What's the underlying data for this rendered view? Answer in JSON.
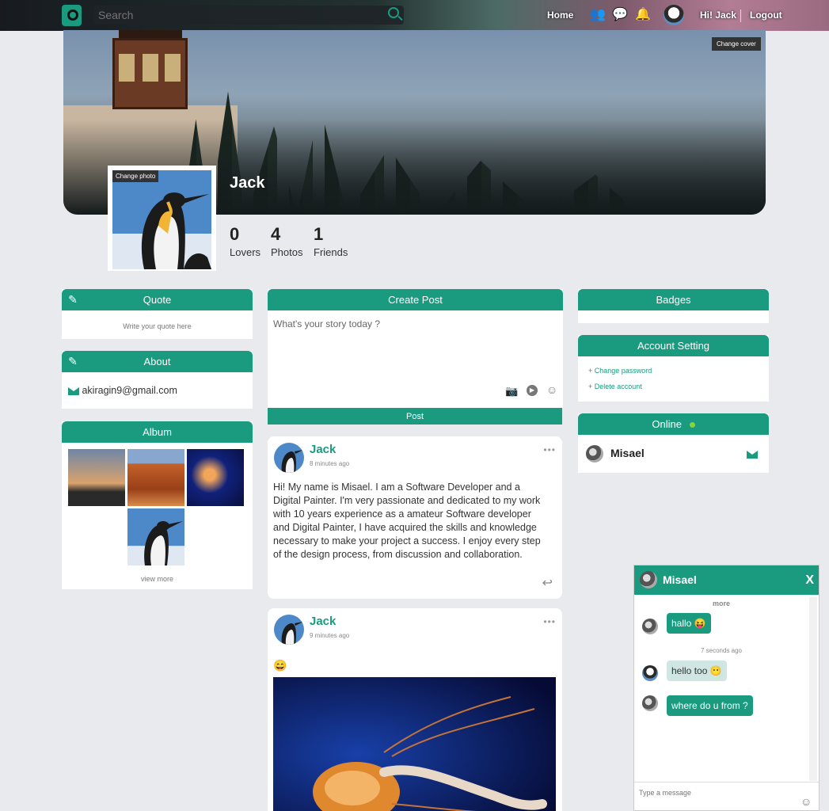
{
  "nav": {
    "search_placeholder": "Search",
    "home": "Home",
    "greeting": "Hi! Jack",
    "logout": "Logout"
  },
  "profile": {
    "name": "Jack",
    "change_cover": "Change cover",
    "change_photo": "Change photo",
    "stats": [
      {
        "num": "0",
        "label": "Lovers"
      },
      {
        "num": "4",
        "label": "Photos"
      },
      {
        "num": "1",
        "label": "Friends"
      }
    ]
  },
  "quote": {
    "title": "Quote",
    "placeholder": "Write your quote here"
  },
  "about": {
    "title": "About",
    "email": "akiragin9@gmail.com"
  },
  "album": {
    "title": "Album",
    "view_more": "view more"
  },
  "create_post": {
    "title": "Create Post",
    "placeholder": "What's your story today ?",
    "post_button": "Post"
  },
  "posts": [
    {
      "author": "Jack",
      "time": "8 minutes ago",
      "text": "Hi! My name is Misael. I am a Software Developer and a Digital Painter. I'm very passionate and dedicated to my work with 10 years experience as a amateur Software developer and Digital Painter, I have acquired the skills and knowledge necessary to make your project a success. I enjoy every step of the design process, from discussion and collaboration."
    },
    {
      "author": "Jack",
      "time": "9 minutes ago",
      "emoji": "😄"
    }
  ],
  "badges": {
    "title": "Badges"
  },
  "account": {
    "title": "Account Setting",
    "change_password": "+ Change password",
    "delete_account": "+ Delete account"
  },
  "online": {
    "title": "Online",
    "user": "Misael"
  },
  "chat": {
    "title": "Misael",
    "close": "X",
    "more": "more",
    "messages": [
      {
        "text": "hallo",
        "emoji": "😝"
      },
      {
        "text": "hello too",
        "emoji": "😶"
      },
      {
        "text": "where do u from ?"
      }
    ],
    "timestamp": "7 seconds ago",
    "input_placeholder": "Type a message"
  },
  "colors": {
    "accent": "#1a9b80",
    "page_bg": "#e9eaed"
  }
}
